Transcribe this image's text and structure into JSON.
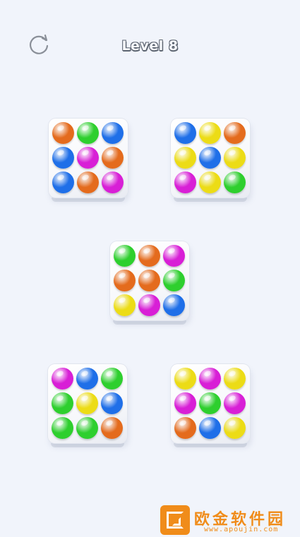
{
  "header": {
    "level_label": "Level 8"
  },
  "icons": {
    "restart": "restart-icon"
  },
  "colors": {
    "orange": "#e46b1d",
    "green": "#2ecf2e",
    "blue": "#1f6fe8",
    "magenta": "#d81fd6",
    "yellow": "#ecdc16",
    "background": "#f1f4fb"
  },
  "trays": [
    {
      "name": "tray-top-left",
      "balls": [
        "orange",
        "green",
        "blue",
        "blue",
        "magenta",
        "orange",
        "blue",
        "orange",
        "magenta"
      ]
    },
    {
      "name": "tray-top-right",
      "balls": [
        "blue",
        "yellow",
        "orange",
        "yellow",
        "blue",
        "yellow",
        "magenta",
        "yellow",
        "green"
      ]
    },
    {
      "name": "tray-middle",
      "balls": [
        "green",
        "orange",
        "magenta",
        "orange",
        "orange",
        "green",
        "yellow",
        "magenta",
        "blue"
      ]
    },
    {
      "name": "tray-bottom-left",
      "balls": [
        "magenta",
        "blue",
        "green",
        "green",
        "yellow",
        "blue",
        "green",
        "green",
        "orange"
      ]
    },
    {
      "name": "tray-bottom-right",
      "balls": [
        "yellow",
        "magenta",
        "yellow",
        "magenta",
        "green",
        "magenta",
        "orange",
        "blue",
        "yellow"
      ]
    }
  ],
  "watermark": {
    "text": "欧金软件园",
    "url": "www.apoujin.com"
  }
}
